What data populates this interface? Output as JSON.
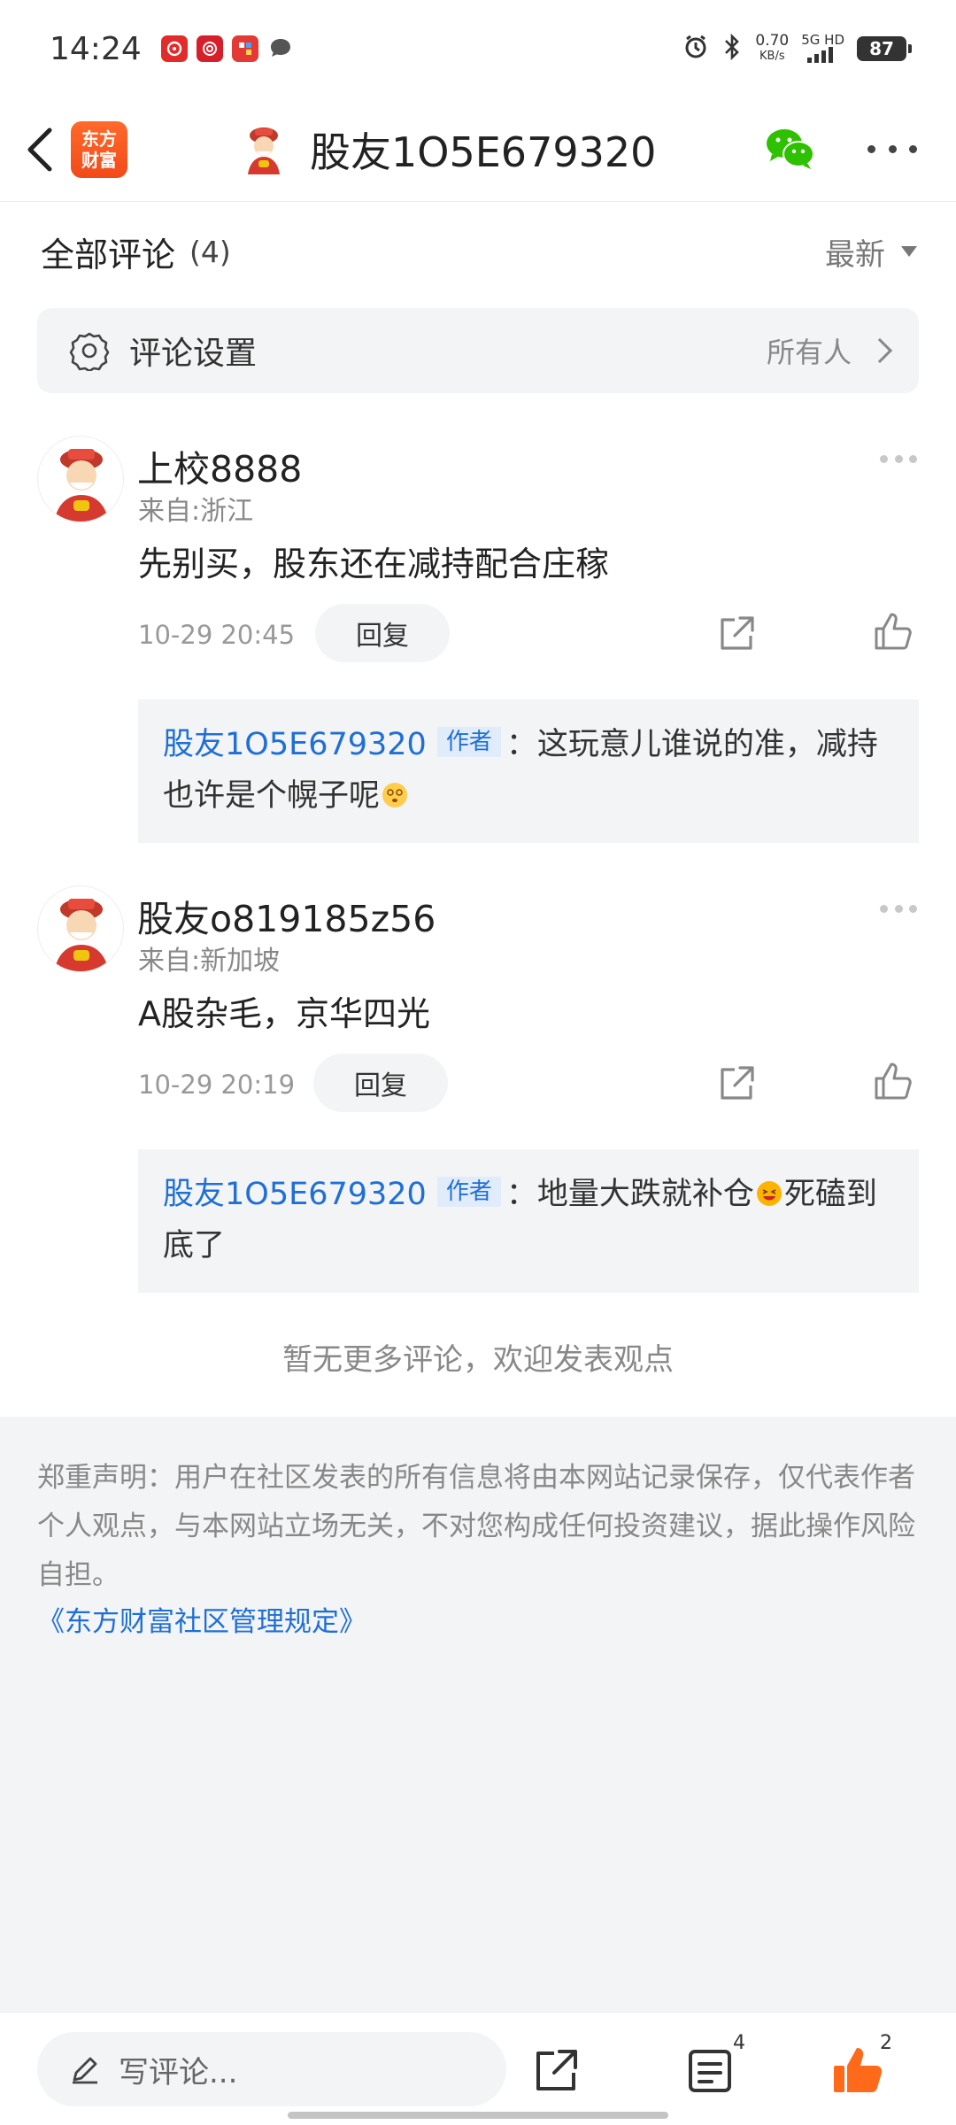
{
  "status_bar": {
    "time": "14:24",
    "net_speed_value": "0.70",
    "net_speed_unit": "KB/s",
    "network_top": "5G HD",
    "network_bottom": "",
    "battery": "87",
    "app_icons": [
      "netease-music-icon",
      "app-icon",
      "app-icon",
      "message-icon"
    ]
  },
  "nav": {
    "brand_line1": "东方",
    "brand_line2": "财富",
    "title": "股友1O5E679320"
  },
  "comments_header": {
    "title": "全部评论",
    "count": "(4)",
    "sort": "最新"
  },
  "settings": {
    "label": "评论设置",
    "value": "所有人"
  },
  "comments": [
    {
      "name": "上校8888",
      "location": "来自:浙江",
      "text": "先别买，股东还在减持配合庄稼",
      "time": "10-29 20:45",
      "reply_label": "回复",
      "reply": {
        "author": "股友1O5E679320",
        "badge": "作者",
        "text_before": "：这玩意儿谁说的准，减持也许是个幌子呢",
        "text_after": ""
      }
    },
    {
      "name": "股友o819185z56",
      "location": "来自:新加坡",
      "text": "A股杂毛，京华四光",
      "time": "10-29 20:19",
      "reply_label": "回复",
      "reply": {
        "author": "股友1O5E679320",
        "badge": "作者",
        "text_before": "：地量大跌就补仓",
        "text_after": "死磕到底了"
      }
    }
  ],
  "no_more": "暂无更多评论，欢迎发表观点",
  "disclaimer": {
    "text": "郑重声明：用户在社区发表的所有信息将由本网站记录保存，仅代表作者个人观点，与本网站立场无关，不对您构成任何投资建议，据此操作风险自担。",
    "link": "《东方财富社区管理规定》"
  },
  "bottom_bar": {
    "write_placeholder": "写评论...",
    "comment_count": "4",
    "like_count": "2"
  },
  "colors": {
    "accent_blue": "#1f6fd6",
    "like_orange": "#ff6a1a",
    "brand_orange": "#f24a1a"
  }
}
